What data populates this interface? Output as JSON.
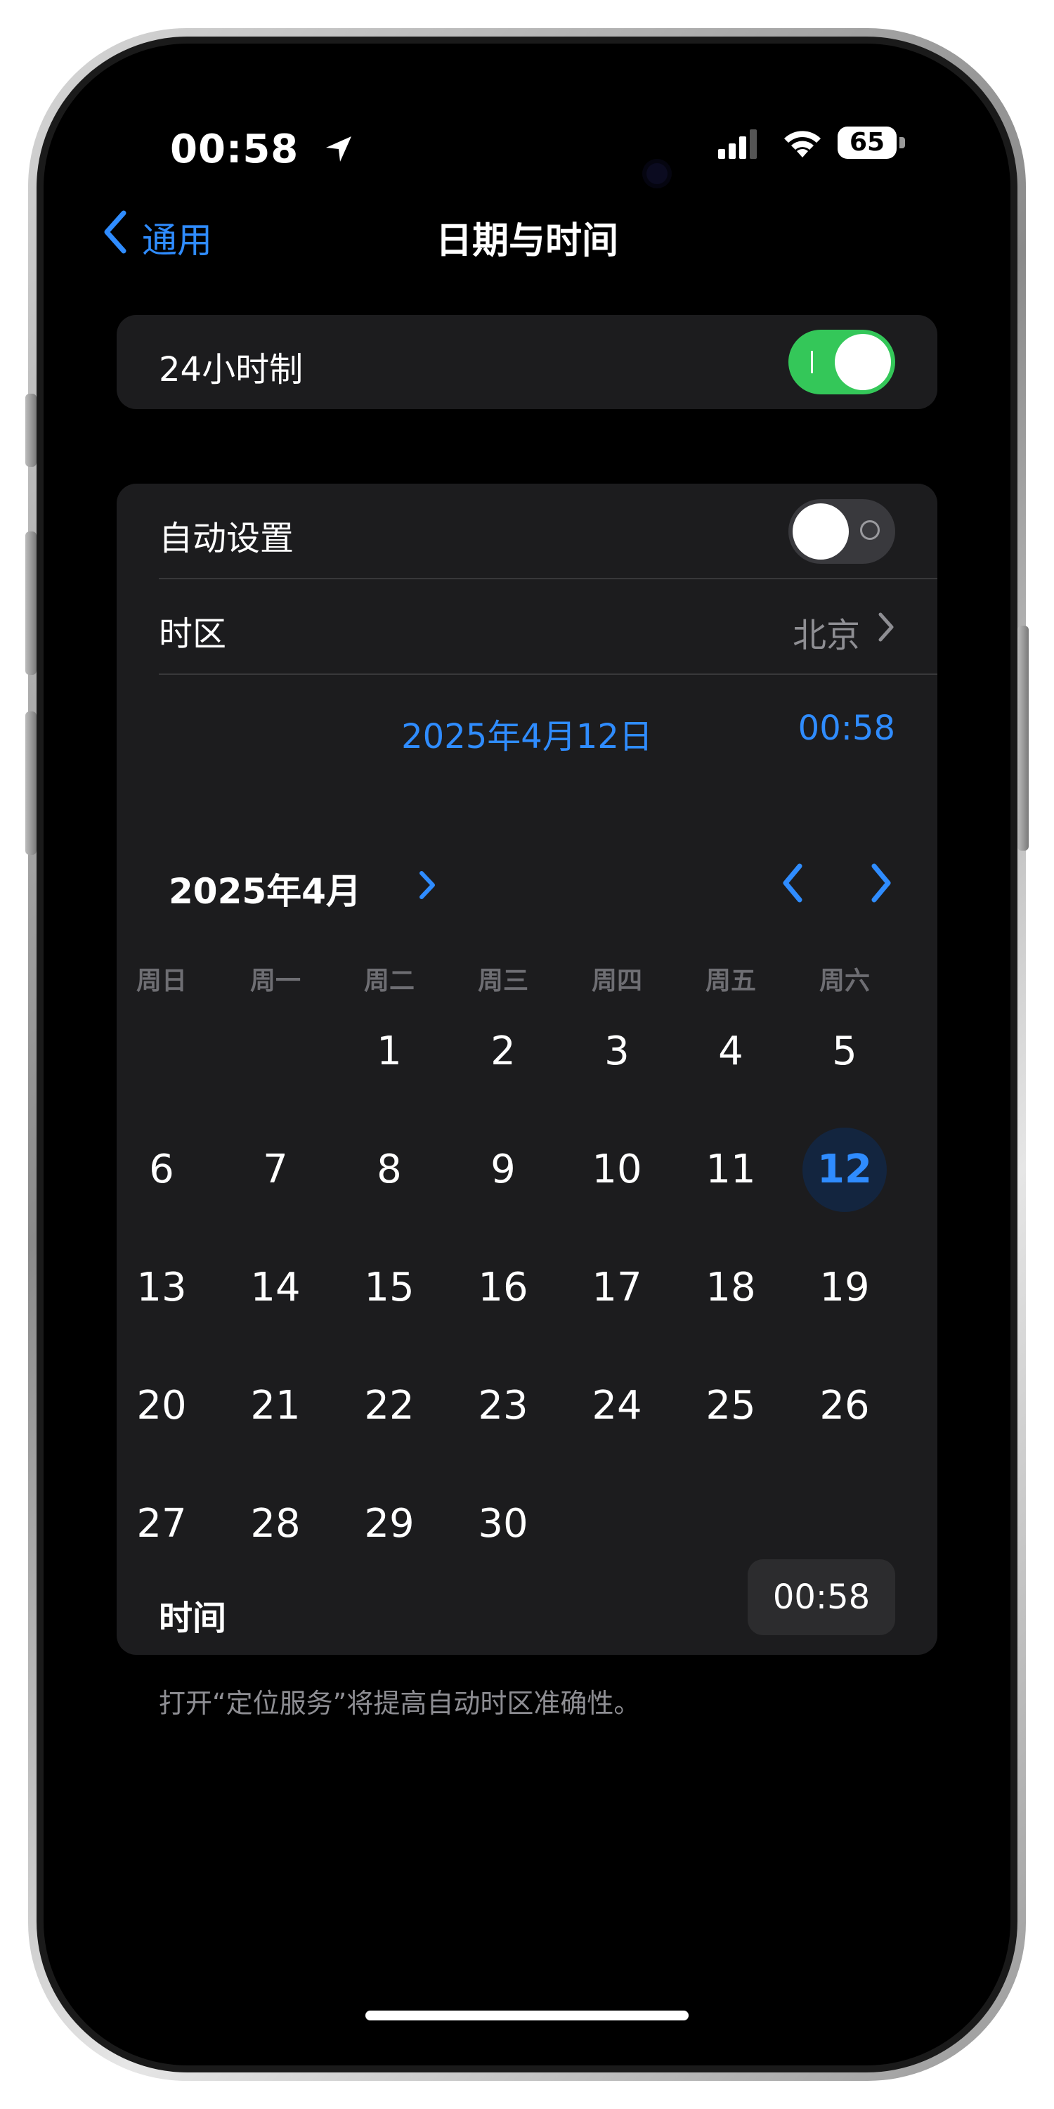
{
  "status_bar": {
    "time": "00:58",
    "battery": "65"
  },
  "nav": {
    "back_label": "通用",
    "title": "日期与时间"
  },
  "settings": {
    "hour24_label": "24小时制",
    "hour24_on": true,
    "auto_label": "自动设置",
    "auto_on": false,
    "timezone_label": "时区",
    "timezone_value": "北京"
  },
  "selection": {
    "date": "2025年4月12日",
    "time": "00:58"
  },
  "calendar": {
    "month_label": "2025年4月",
    "weekdays": [
      "周日",
      "周一",
      "周二",
      "周三",
      "周四",
      "周五",
      "周六"
    ],
    "first_weekday_index": 2,
    "days": [
      "1",
      "2",
      "3",
      "4",
      "5",
      "6",
      "7",
      "8",
      "9",
      "10",
      "11",
      "12",
      "13",
      "14",
      "15",
      "16",
      "17",
      "18",
      "19",
      "20",
      "21",
      "22",
      "23",
      "24",
      "25",
      "26",
      "27",
      "28",
      "29",
      "30"
    ],
    "selected_day": "12"
  },
  "time_row": {
    "label": "时间",
    "value": "00:58"
  },
  "footer": {
    "note": "打开“定位服务”将提高自动时区准确性。"
  },
  "colors": {
    "accent": "#2f8cff",
    "toggle_on": "#34c759",
    "card": "#1c1c1e",
    "background": "#000000"
  }
}
